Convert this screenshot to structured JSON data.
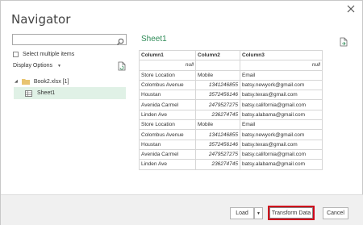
{
  "window": {
    "title": "Navigator"
  },
  "left": {
    "search_placeholder": "",
    "select_multiple_label": "Select multiple items",
    "display_options_label": "Display Options",
    "tree": {
      "workbook_label": "Book2.xlsx [1]",
      "sheet_label": "Sheet1"
    }
  },
  "preview": {
    "title": "Sheet1",
    "columns": [
      "Column1",
      "Column2",
      "Column3"
    ],
    "rows": [
      [
        "null",
        "",
        "null"
      ],
      [
        "Store Location",
        "Mobile",
        "Email"
      ],
      [
        "Colombus Avenue",
        "1341246855",
        "batsy.newyork@gmail.com"
      ],
      [
        "Houstan",
        "3572456146",
        "batsy.texas@gmail.com"
      ],
      [
        "Avenida Carmel",
        "2479527275",
        "batsy.california@gmail.com"
      ],
      [
        "Linden Ave",
        "236274745",
        "batsy.alabama@gmail.com"
      ],
      [
        "Store Location",
        "Mobile",
        "Email"
      ],
      [
        "Colombus Avenue",
        "1341246855",
        "batsy.newyork@gmail.com"
      ],
      [
        "Houstan",
        "3572456146",
        "batsy.texas@gmail.com"
      ],
      [
        "Avenida Carmel",
        "2479527275",
        "batsy.california@gmail.com"
      ],
      [
        "Linden Ave",
        "236274745",
        "batsy.alabama@gmail.com"
      ]
    ]
  },
  "footer": {
    "load_label": "Load",
    "transform_label": "Transform Data",
    "cancel_label": "Cancel"
  },
  "colors": {
    "accent_green": "#2e8b57",
    "selected_row": "#e0f1e6",
    "highlight_border": "#d0021b"
  }
}
